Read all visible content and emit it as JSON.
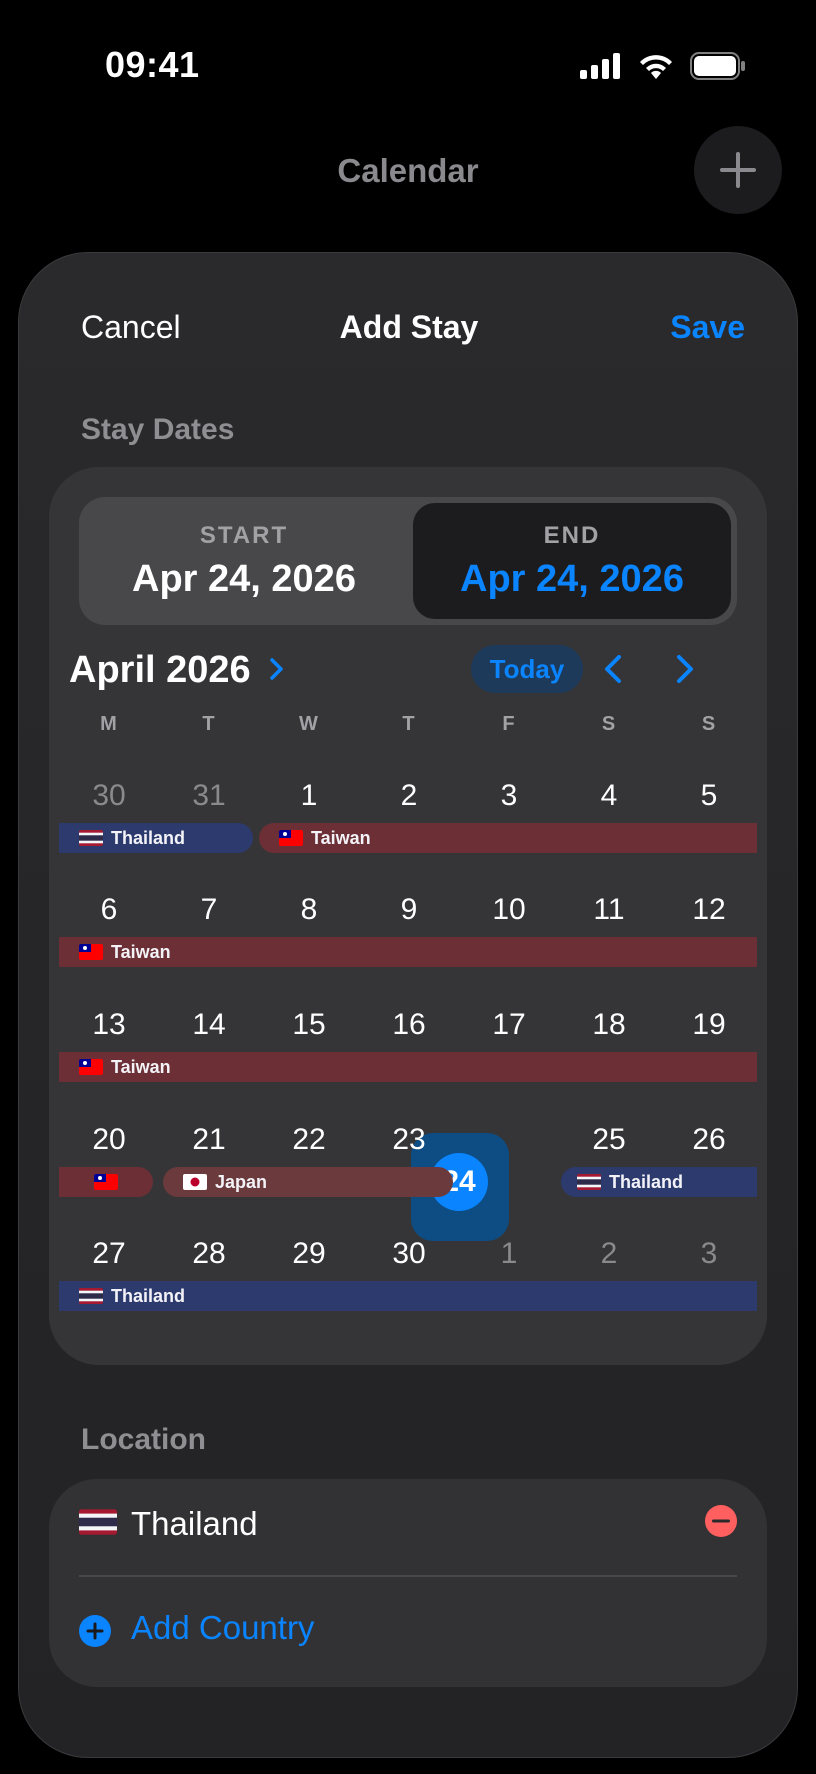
{
  "status_bar": {
    "time": "09:41"
  },
  "background": {
    "title": "Calendar"
  },
  "sheet": {
    "cancel_label": "Cancel",
    "title": "Add Stay",
    "save_label": "Save",
    "stay_dates_label": "Stay Dates",
    "start_caption": "START",
    "start_value": "Apr 24, 2026",
    "end_caption": "END",
    "end_value": "Apr 24, 2026",
    "month_title": "April 2026",
    "today_label": "Today",
    "weekdays": [
      "M",
      "T",
      "W",
      "T",
      "F",
      "S",
      "S"
    ],
    "weeks": [
      [
        "30",
        "31",
        "1",
        "2",
        "3",
        "4",
        "5"
      ],
      [
        "6",
        "7",
        "8",
        "9",
        "10",
        "11",
        "12"
      ],
      [
        "13",
        "14",
        "15",
        "16",
        "17",
        "18",
        "19"
      ],
      [
        "20",
        "21",
        "22",
        "23",
        "24",
        "25",
        "26"
      ],
      [
        "27",
        "28",
        "29",
        "30",
        "1",
        "2",
        "3"
      ]
    ],
    "selected_day": "24",
    "stay_labels": {
      "thailand": "Thailand",
      "taiwan": "Taiwan",
      "japan": "Japan"
    },
    "location_label": "Location",
    "location_country": "Thailand",
    "add_country_label": "Add Country"
  },
  "colors": {
    "accent": "#0a84ff",
    "thailand_bar": "#2c3a6e",
    "taiwan_bar": "#6b2f35",
    "japan_bar": "#6a3a3d",
    "remove": "#ff5f5f"
  },
  "icons": [
    "signal-icon",
    "wifi-icon",
    "battery-icon",
    "plus-icon",
    "chevron-right-icon",
    "chevron-left-icon",
    "minus-icon",
    "thailand-flag-icon",
    "taiwan-flag-icon",
    "japan-flag-icon"
  ]
}
